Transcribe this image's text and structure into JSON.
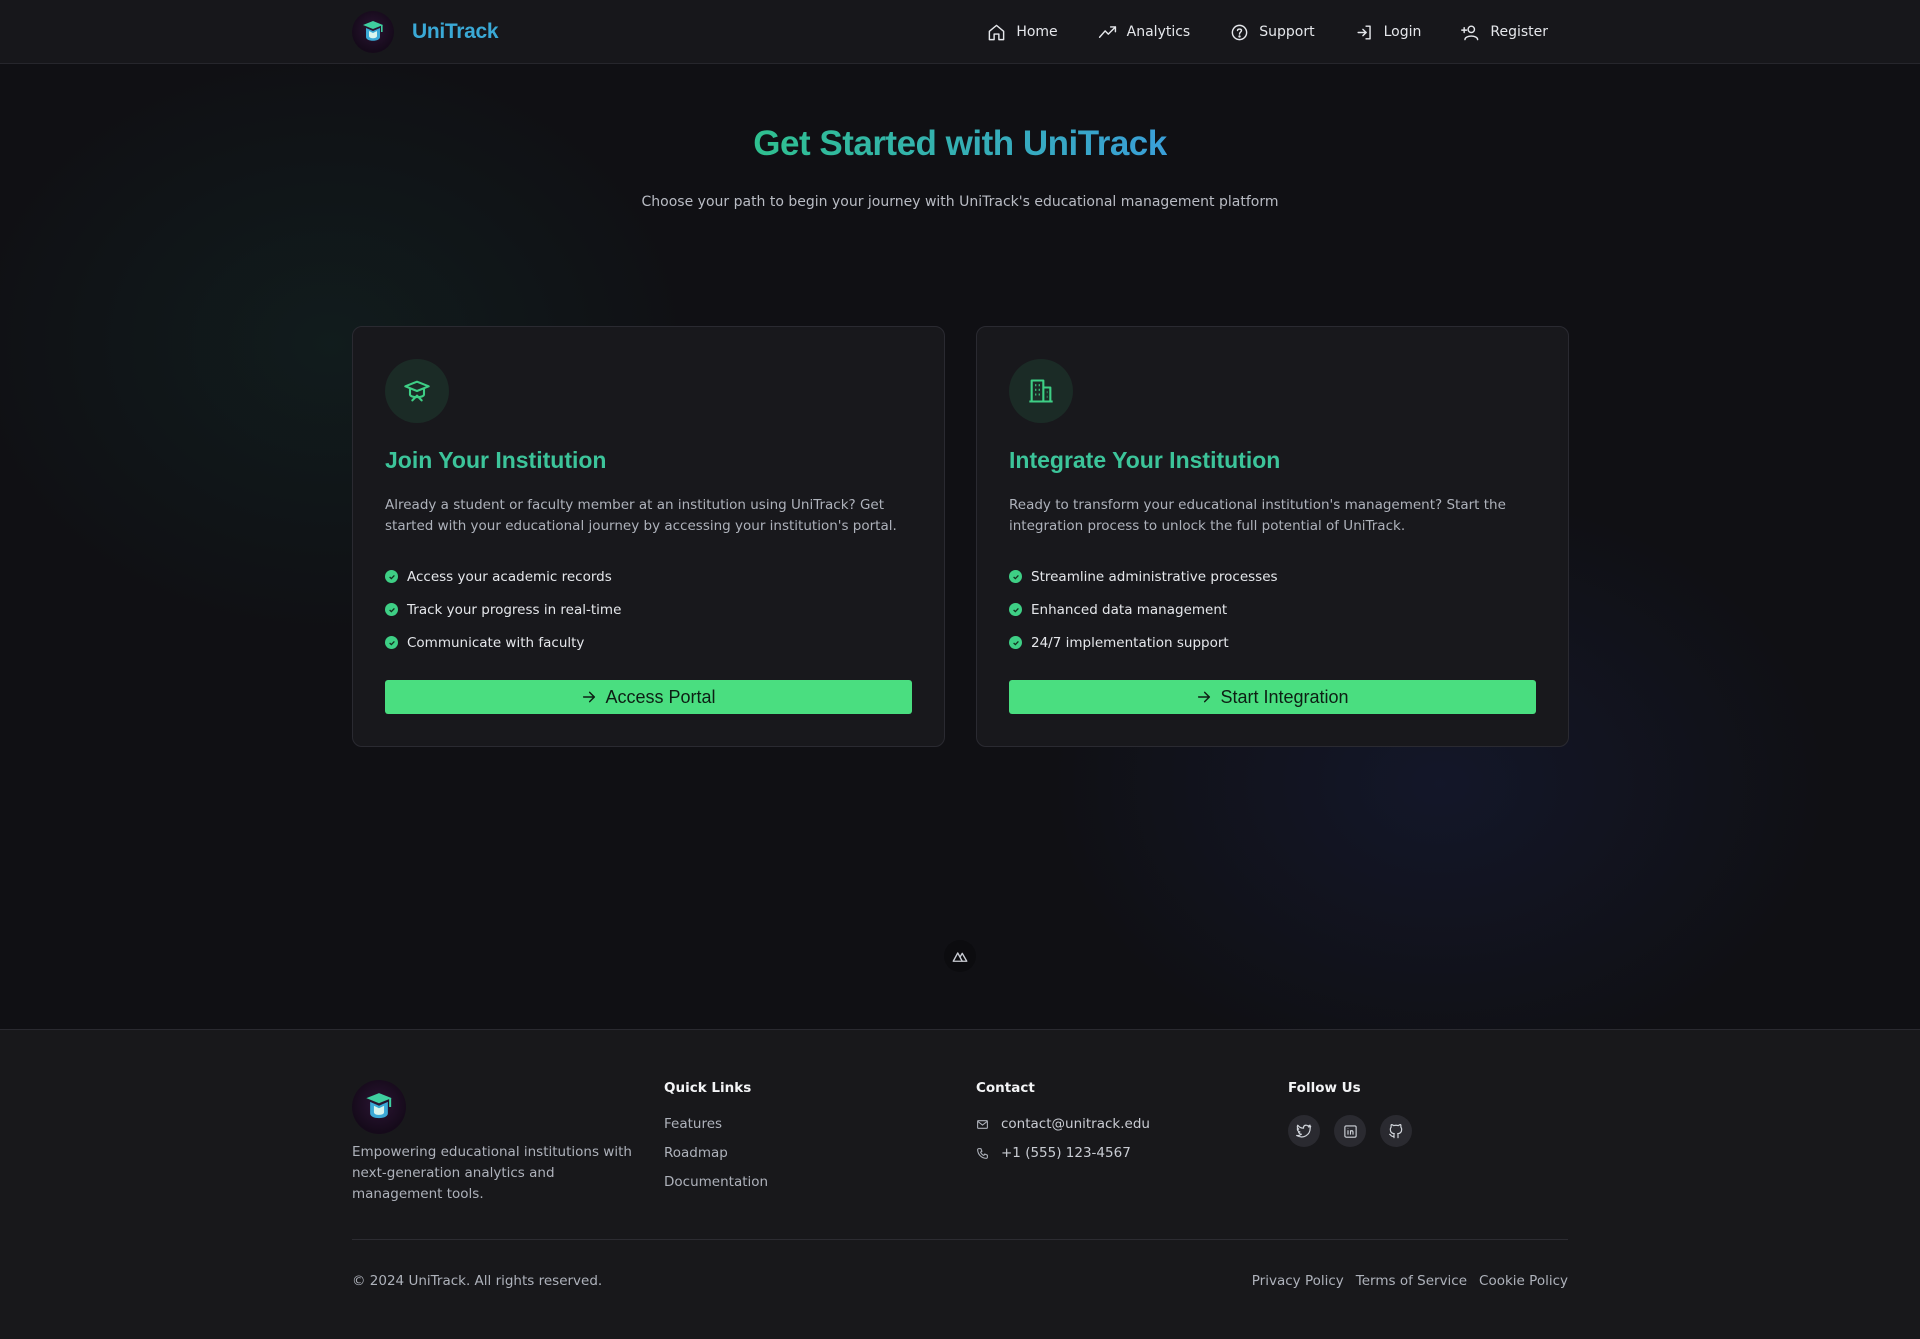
{
  "header": {
    "brand": "UniTrack",
    "nav": [
      {
        "label": "Home",
        "icon": "home-icon"
      },
      {
        "label": "Analytics",
        "icon": "analytics-icon"
      },
      {
        "label": "Support",
        "icon": "help-circle-icon"
      },
      {
        "label": "Login",
        "icon": "login-icon"
      },
      {
        "label": "Register",
        "icon": "user-plus-icon"
      }
    ]
  },
  "hero": {
    "title": "Get Started with UniTrack",
    "subtitle": "Choose your path to begin your journey with UniTrack's educational management platform"
  },
  "cards": [
    {
      "icon": "graduation-cap-icon",
      "title": "Join Your Institution",
      "description": "Already a student or faculty member at an institution using UniTrack? Get started with your educational journey by accessing your institution's portal.",
      "features": [
        "Access your academic records",
        "Track your progress in real-time",
        "Communicate with faculty"
      ],
      "cta": "Access Portal"
    },
    {
      "icon": "building-icon",
      "title": "Integrate Your Institution",
      "description": "Ready to transform your educational institution's management? Start the integration process to unlock the full potential of UniTrack.",
      "features": [
        "Streamline administrative processes",
        "Enhanced data management",
        "24/7 implementation support"
      ],
      "cta": "Start Integration"
    }
  ],
  "footer": {
    "tagline": "Empowering educational institutions with next-generation analytics and management tools.",
    "quick_links_title": "Quick Links",
    "quick_links": [
      "Features",
      "Roadmap",
      "Documentation"
    ],
    "contact_title": "Contact",
    "email": "contact@unitrack.edu",
    "phone": "+1 (555) 123-4567",
    "follow_title": "Follow Us",
    "social": [
      "twitter-icon",
      "linkedin-icon",
      "github-icon"
    ],
    "copyright": "© 2024 UniTrack. All rights reserved.",
    "legal": [
      "Privacy Policy",
      "Terms of Service",
      "Cookie Policy"
    ]
  },
  "colors": {
    "accent_green": "#4ade80",
    "heading_teal": "#3cc49a",
    "brand_blue": "#3aa9d6",
    "background": "#111114"
  }
}
